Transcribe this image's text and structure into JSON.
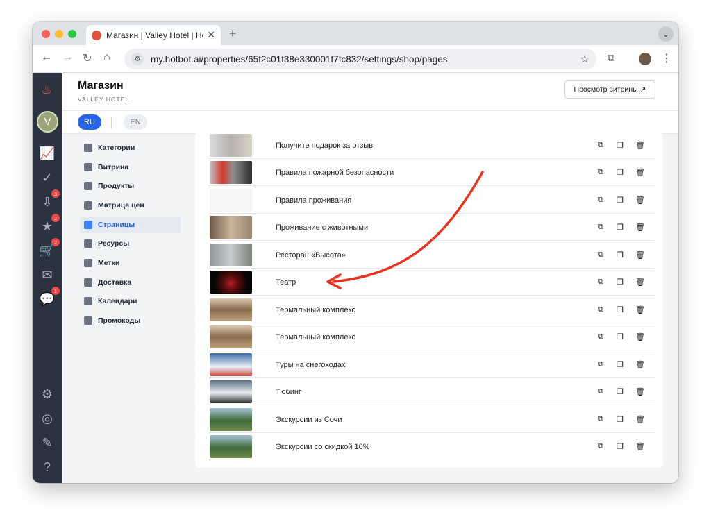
{
  "browser": {
    "tab_title": "Магазин | Valley Hotel | Hotbot",
    "url": "my.hotbot.ai/properties/65f2c01f38e330001f7fc832/settings/shop/pages"
  },
  "rail": {
    "badges": {
      "downloads": "3",
      "reviews": "2",
      "cart": "2",
      "chat": "1"
    },
    "property_initial": "V"
  },
  "header": {
    "title": "Магазин",
    "subtitle": "VALLEY HOTEL",
    "view_button": "Просмотр витрины ↗"
  },
  "langs": {
    "ru": "RU",
    "en": "EN"
  },
  "menu": [
    "Категории",
    "Витрина",
    "Продукты",
    "Матрица цен",
    "Страницы",
    "Ресурсы",
    "Метки",
    "Доставка",
    "Календари",
    "Промокоды"
  ],
  "pages": [
    "Получите подарок за отзыв",
    "Правила пожарной безопасности",
    "Правила проживания",
    "Проживание с животными",
    "Ресторан «Высота»",
    "Театр",
    "Термальный комплекс",
    "Термальный комплекс",
    "Туры на снегоходах",
    "Тюбинг",
    "Экскурсии из Сочи",
    "Экскурсии со скидкой 10%"
  ],
  "colors": {
    "accent": "#2563eb",
    "arrow": "#e8321e",
    "rail": "#2c3340"
  }
}
